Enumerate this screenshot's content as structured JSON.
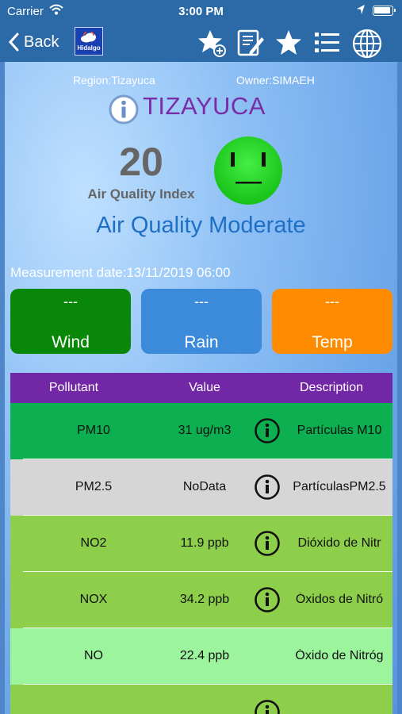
{
  "status_bar": {
    "carrier": "Carrier",
    "time": "3:00 PM"
  },
  "nav": {
    "back_label": "Back",
    "logo_text": "Hidalgo",
    "icons": [
      "star-add-icon",
      "edit-document-icon",
      "star-icon",
      "list-icon",
      "globe-icon"
    ]
  },
  "station": {
    "region": "Region:Tizayuca",
    "owner": "Owner:SIMAEH",
    "name": "TIZAYUCA",
    "aqi_value": "20",
    "aqi_label": "Air Quality Index",
    "quality_text": "Air Quality Moderate",
    "face_color": "#22dd22",
    "measurement_date": "Measurement date:13/11/2019 06:00"
  },
  "weather": [
    {
      "value": "---",
      "label": "Wind",
      "color": "#098709"
    },
    {
      "value": "---",
      "label": "Rain",
      "color": "#3c8ada"
    },
    {
      "value": "---",
      "label": "Temp",
      "color": "#ff8c00"
    }
  ],
  "table": {
    "headers": [
      "Pollutant",
      "Value",
      "Description"
    ],
    "header_color": "#7227a6",
    "rows": [
      {
        "pollutant": "PM10",
        "value": "31 ug/m3",
        "description": "Partículas M10",
        "color": "#0db050",
        "has_info": true
      },
      {
        "pollutant": "PM2.5",
        "value": "NoData",
        "description": "PartículasPM2.5",
        "color": "#d6d6d6",
        "has_info": true
      },
      {
        "pollutant": "NO2",
        "value": "11.9 ppb",
        "description": "Dióxido de Nitr",
        "color": "#8dcf4a",
        "has_info": true
      },
      {
        "pollutant": "NOX",
        "value": "34.2 ppb",
        "description": "Óxidos de Nitró",
        "color": "#8dcf4a",
        "has_info": true
      },
      {
        "pollutant": "NO",
        "value": "22.4 ppb",
        "description": "Óxido de Nitróg",
        "color": "#9cf59c",
        "has_info": false
      },
      {
        "pollutant": "",
        "value": "",
        "description": "",
        "color": "#8dcf4a",
        "has_info": true
      }
    ]
  }
}
